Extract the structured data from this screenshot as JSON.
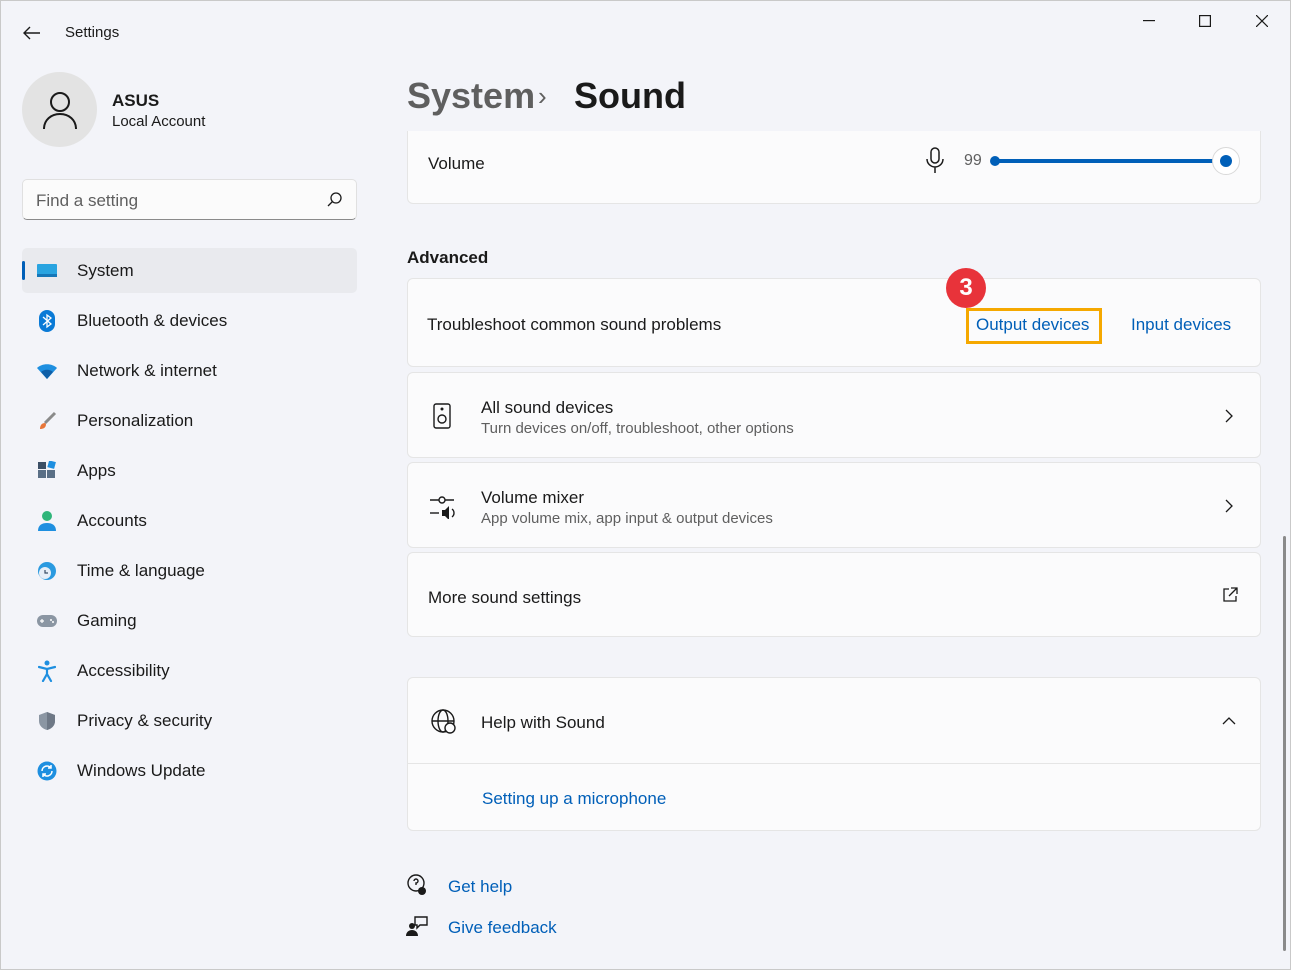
{
  "window": {
    "title": "Settings",
    "controls": [
      "minimize",
      "maximize",
      "close"
    ]
  },
  "user": {
    "name": "ASUS",
    "account_type": "Local Account"
  },
  "search": {
    "placeholder": "Find a setting"
  },
  "sidebar": {
    "items": [
      {
        "label": "System",
        "icon": "system-icon",
        "active": true
      },
      {
        "label": "Bluetooth & devices",
        "icon": "bluetooth-icon"
      },
      {
        "label": "Network & internet",
        "icon": "wifi-icon"
      },
      {
        "label": "Personalization",
        "icon": "brush-icon"
      },
      {
        "label": "Apps",
        "icon": "apps-icon"
      },
      {
        "label": "Accounts",
        "icon": "accounts-icon"
      },
      {
        "label": "Time & language",
        "icon": "globe-clock-icon"
      },
      {
        "label": "Gaming",
        "icon": "gamepad-icon"
      },
      {
        "label": "Accessibility",
        "icon": "accessibility-icon"
      },
      {
        "label": "Privacy & security",
        "icon": "shield-icon"
      },
      {
        "label": "Windows Update",
        "icon": "update-icon"
      }
    ]
  },
  "breadcrumb": {
    "parent": "System",
    "separator": "›",
    "current": "Sound"
  },
  "volume": {
    "label": "Volume",
    "value": "99",
    "level_percent": 99
  },
  "advanced": {
    "heading": "Advanced",
    "troubleshoot": {
      "label": "Troubleshoot common sound problems",
      "output_link": "Output devices",
      "input_link": "Input devices"
    },
    "all_devices": {
      "title": "All sound devices",
      "subtitle": "Turn devices on/off, troubleshoot, other options"
    },
    "mixer": {
      "title": "Volume mixer",
      "subtitle": "App volume mix, app input & output devices"
    },
    "more_settings": {
      "title": "More sound settings"
    }
  },
  "help": {
    "title": "Help with Sound",
    "link": "Setting up a microphone"
  },
  "footer": {
    "get_help": "Get help",
    "give_feedback": "Give feedback"
  },
  "annotation": {
    "step_number": "3",
    "highlight_color": "#f5a800",
    "badge_color": "#e8333a"
  },
  "colors": {
    "accent": "#005fb8"
  }
}
